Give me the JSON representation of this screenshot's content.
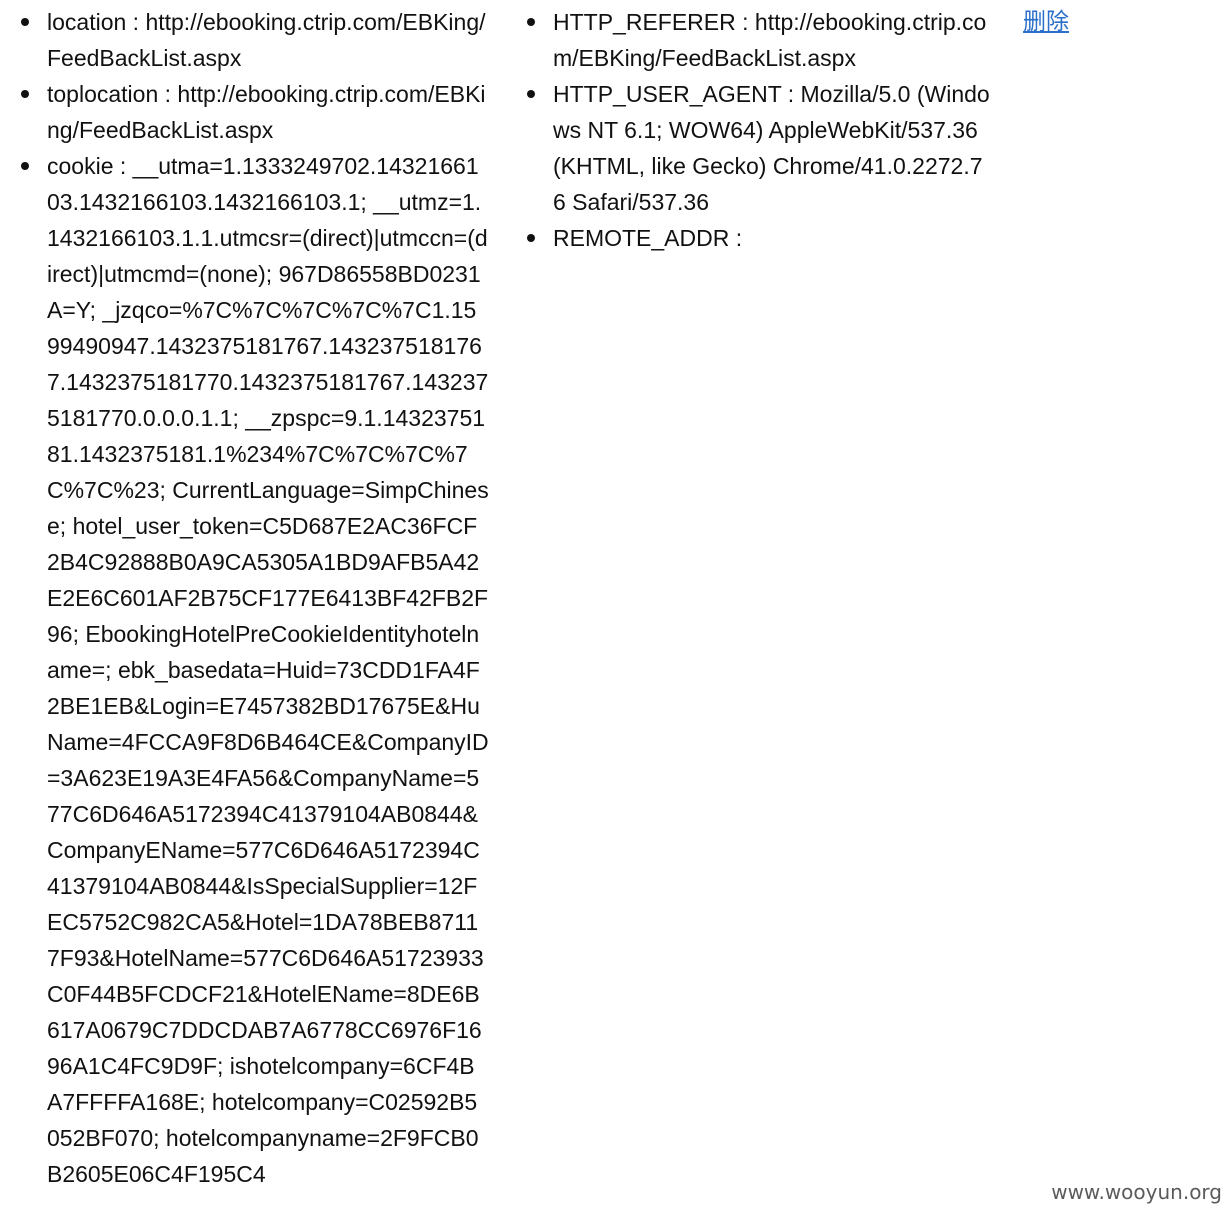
{
  "left_list": [
    {
      "key": "location",
      "text": "location : http://ebooking.ctrip.com/EBKing/FeedBackList.aspx"
    },
    {
      "key": "toplocation",
      "text": "toplocation : http://ebooking.ctrip.com/EBKing/FeedBackList.aspx"
    },
    {
      "key": "cookie",
      "text": "cookie : __utma=1.1333249702.1432166103.1432166103.1432166103.1; __utmz=1.1432166103.1.1.utmcsr=(direct)|utmccn=(direct)|utmcmd=(none); 967D86558BD0231A=Y; _jzqco=%7C%7C%7C%7C%7C1.1599490947.1432375181767.1432375181767.1432375181770.1432375181767.1432375181770.0.0.0.1.1; __zpspc=9.1.1432375181.1432375181.1%234%7C%7C%7C%7C%7C%23; CurrentLanguage=SimpChinese; hotel_user_token=C5D687E2AC36FCF2B4C92888B0A9CA5305A1BD9AFB5A42E2E6C601AF2B75CF177E6413BF42FB2F96; EbookingHotelPreCookieIdentityhotelname=; ebk_basedata=Huid=73CDD1FA4F2BE1EB&Login=E7457382BD17675E&HuName=4FCCA9F8D6B464CE&CompanyID=3A623E19A3E4FA56&CompanyName=577C6D646A5172394C41379104AB0844&CompanyEName=577C6D646A5172394C41379104AB0844&IsSpecialSupplier=12FEC5752C982CA5&Hotel=1DA78BEB87117F93&HotelName=577C6D646A51723933C0F44B5FCDCF21&HotelEName=8DE6B617A0679C7DDCDAB7A6778CC6976F1696A1C4FC9D9F; ishotelcompany=6CF4BA7FFFFA168E; hotelcompany=C02592B5052BF070; hotelcompanyname=2F9FCB0B2605E06C4F195C4"
    }
  ],
  "right_list": [
    {
      "key": "http-referer",
      "text": "HTTP_REFERER : http://ebooking.ctrip.com/EBKing/FeedBackList.aspx"
    },
    {
      "key": "http-user-agent",
      "text": "HTTP_USER_AGENT : Mozilla/5.0 (Windows NT 6.1; WOW64) AppleWebKit/537.36 (KHTML, like Gecko) Chrome/41.0.2272.76 Safari/537.36"
    },
    {
      "key": "remote-addr",
      "text": "REMOTE_ADDR :"
    }
  ],
  "delete_label": "删除",
  "watermark": "www.wooyun.org",
  "colors": {
    "link": "#2a6fc9",
    "text": "#111111",
    "background": "#ffffff"
  }
}
